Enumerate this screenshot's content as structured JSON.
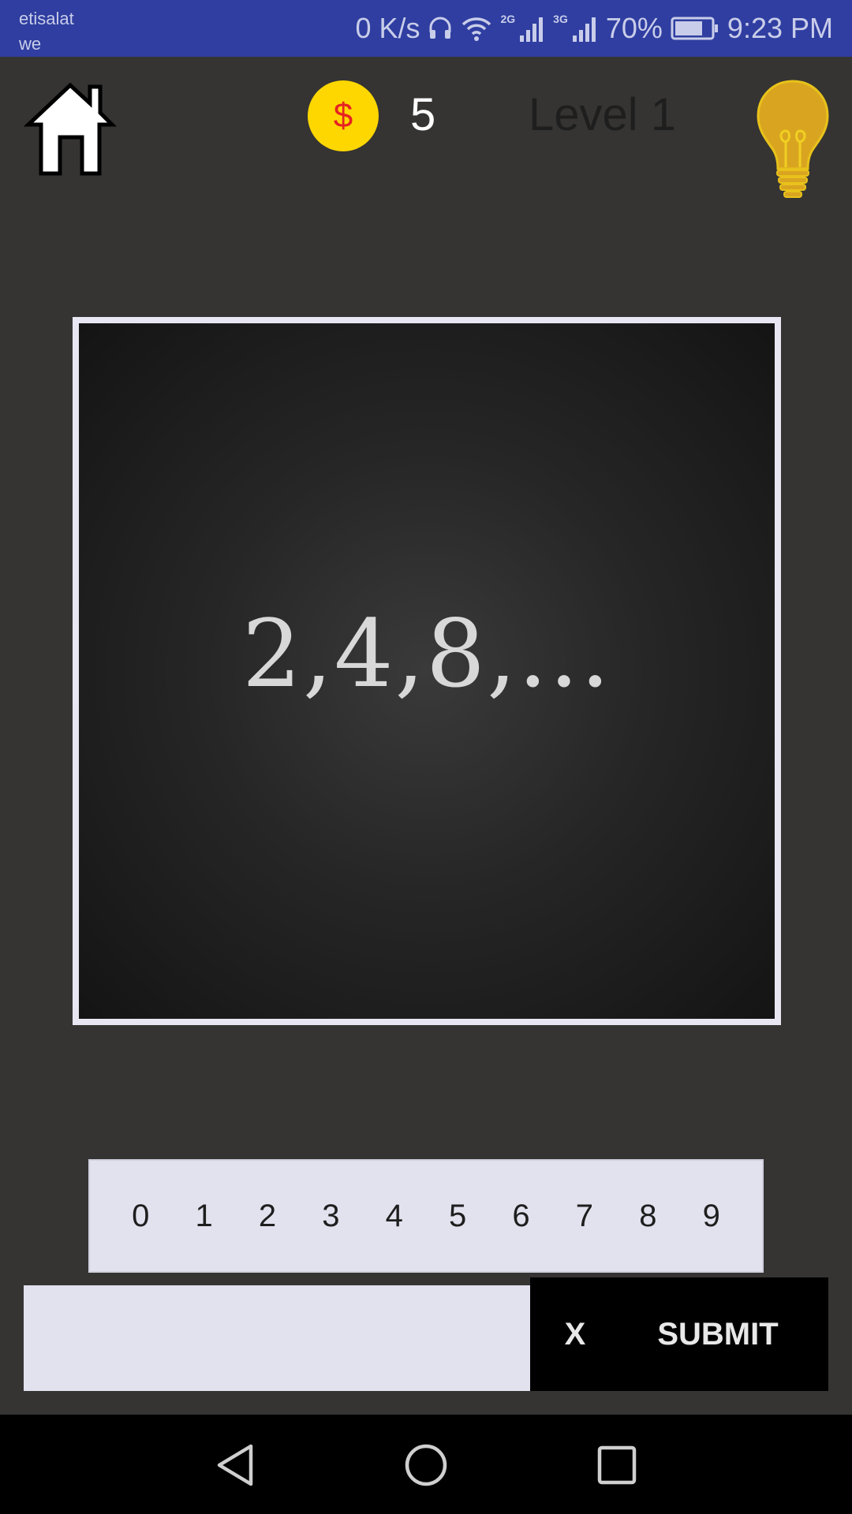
{
  "status_bar": {
    "carrier_line1": "etisalat",
    "carrier_line2": "we",
    "net_speed": "0 K/s",
    "signal1_label": "2G",
    "signal2_label": "3G",
    "battery": "70%",
    "time": "9:23 PM"
  },
  "top_bar": {
    "coin_symbol": "$",
    "coin_count": "5",
    "level_label": "Level 1"
  },
  "puzzle": {
    "text": "2,4,8,..."
  },
  "keypad": {
    "digits": [
      "0",
      "1",
      "2",
      "3",
      "4",
      "5",
      "6",
      "7",
      "8",
      "9"
    ]
  },
  "answer": {
    "value": "",
    "clear_label": "X",
    "submit_label": "SUBMIT"
  },
  "icons": {
    "home": "home-icon",
    "hint": "lightbulb-icon",
    "back": "back-triangle-icon",
    "home_nav": "home-circle-icon",
    "recents": "recents-square-icon"
  },
  "colors": {
    "status_bar": "#2f3ea0",
    "background": "#353433",
    "coin": "#ffd700",
    "coin_symbol": "#e52222",
    "bulb": "#d9a520",
    "keypad": "#e2e1ee",
    "action_bar": "#000000"
  }
}
